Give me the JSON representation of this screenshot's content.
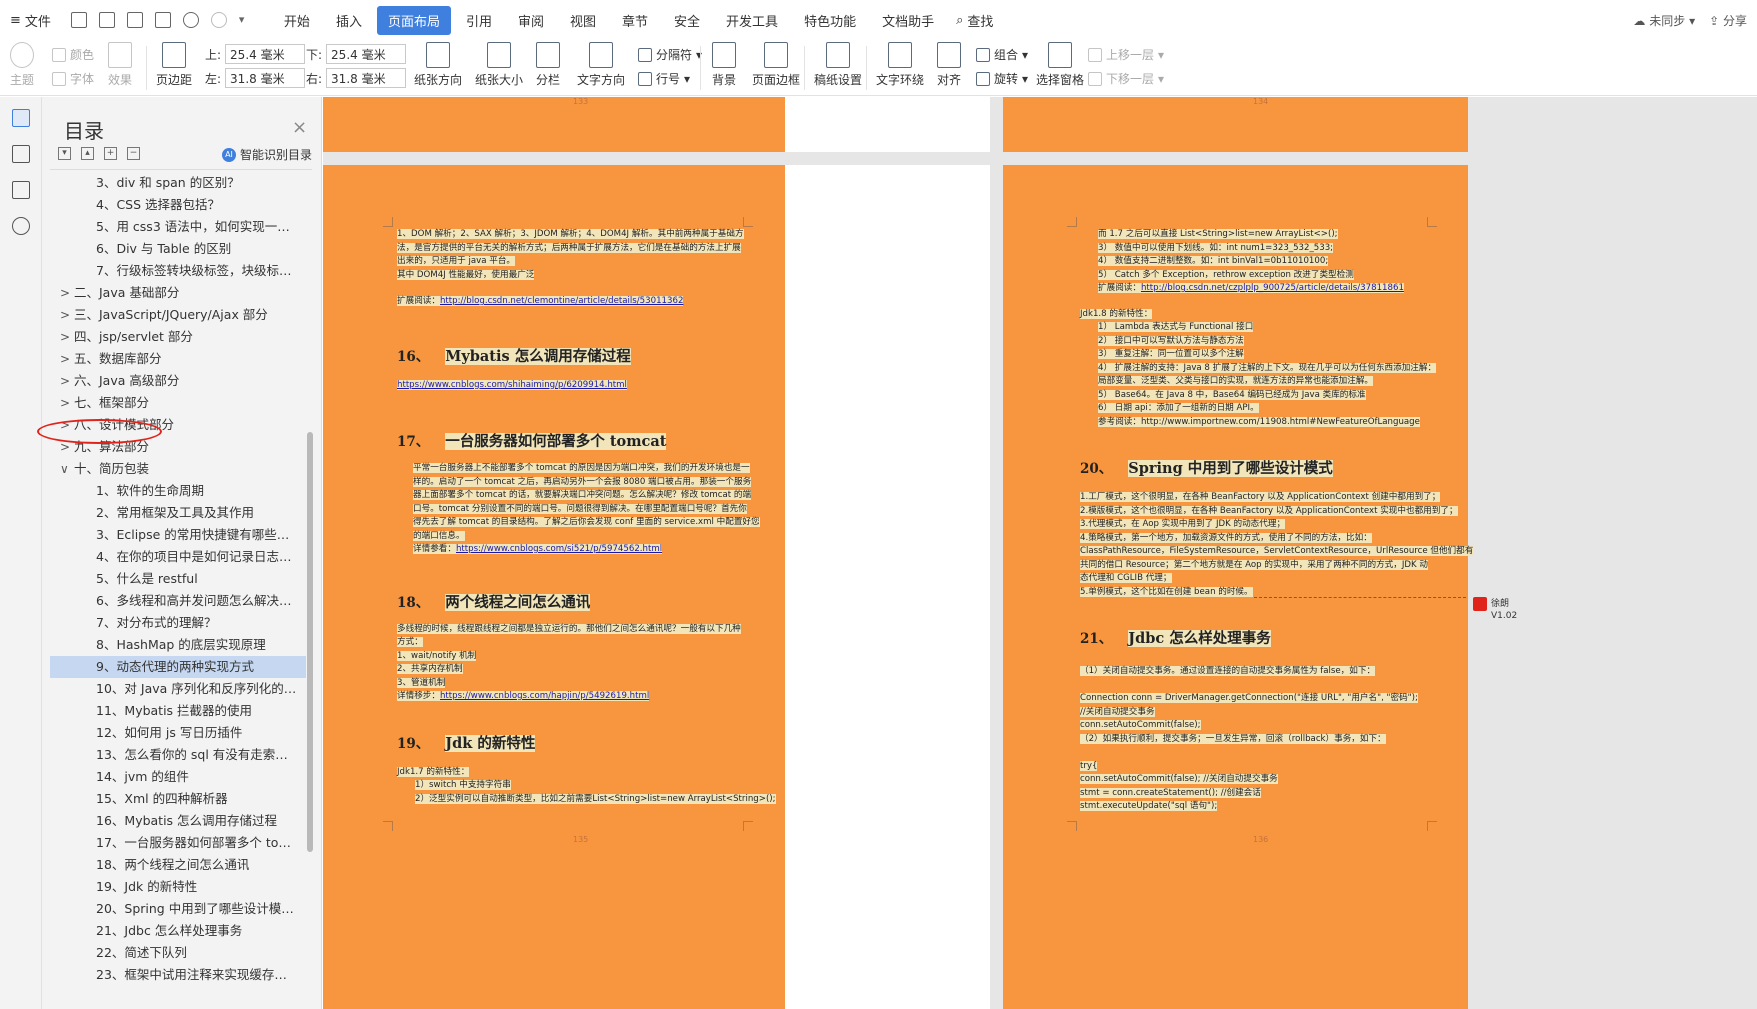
{
  "menubar": {
    "file_label": "文件",
    "tabs": [
      "开始",
      "插入",
      "页面布局",
      "引用",
      "审阅",
      "视图",
      "章节",
      "安全",
      "开发工具",
      "特色功能",
      "文档助手"
    ],
    "active_tab": "页面布局",
    "search_label": "查找",
    "sync_label": "未同步",
    "share_label": "分享"
  },
  "ribbon": {
    "theme": "主题",
    "color": "颜色",
    "font": "字体",
    "effect": "效果",
    "margin": "页边距",
    "top_label": "上:",
    "top_value": "25.4 毫米",
    "bottom_label": "下:",
    "bottom_value": "25.4 毫米",
    "left_label": "左:",
    "left_value": "31.8 毫米",
    "right_label": "右:",
    "right_value": "31.8 毫米",
    "orientation": "纸张方向",
    "size": "纸张大小",
    "columns": "分栏",
    "text_direction": "文字方向",
    "breaks": "分隔符",
    "line_numbers": "行号",
    "background": "背景",
    "page_border": "页面边框",
    "manuscript": "稿纸设置",
    "text_wrap": "文字环绕",
    "align": "对齐",
    "group": "组合",
    "rotate": "旋转",
    "selection_pane": "选择窗格",
    "bring_forward": "上移一层",
    "send_backward": "下移一层"
  },
  "toc": {
    "title": "目录",
    "smart_label": "智能识别目录",
    "items": [
      {
        "text": "3、div 和 span 的区别？",
        "level": 2
      },
      {
        "text": "4、CSS 选择器包括？",
        "level": 2
      },
      {
        "text": "5、用 css3 语法中，如何实现一…",
        "level": 2
      },
      {
        "text": "6、Div 与 Table 的区别",
        "level": 2
      },
      {
        "text": "7、行级标签转块级标签，块级标…",
        "level": 2
      },
      {
        "text": "二、Java 基础部分",
        "level": 1,
        "caret": ">"
      },
      {
        "text": "三、JavaScript/JQuery/Ajax 部分",
        "level": 1,
        "caret": ">"
      },
      {
        "text": "四、jsp/servlet 部分",
        "level": 1,
        "caret": ">"
      },
      {
        "text": "五、数据库部分",
        "level": 1,
        "caret": ">"
      },
      {
        "text": "六、Java 高级部分",
        "level": 1,
        "caret": ">"
      },
      {
        "text": "七、框架部分",
        "level": 1,
        "caret": ">"
      },
      {
        "text": "八、设计模式部分",
        "level": 1,
        "caret": ">"
      },
      {
        "text": "九、算法部分",
        "level": 1,
        "caret": ">"
      },
      {
        "text": "十、简历包装",
        "level": 1,
        "caret": "∨"
      },
      {
        "text": "1、软件的生命周期",
        "level": 2
      },
      {
        "text": "2、常用框架及工具及其作用",
        "level": 2
      },
      {
        "text": "3、Eclipse 的常用快捷键有哪些…",
        "level": 2
      },
      {
        "text": "4、在你的项目中是如何记录日志…",
        "level": 2
      },
      {
        "text": "5、什么是 restful",
        "level": 2
      },
      {
        "text": "6、多线程和高并发问题怎么解决…",
        "level": 2
      },
      {
        "text": "7、对分布式的理解？",
        "level": 2
      },
      {
        "text": "8、HashMap 的底层实现原理",
        "level": 2
      },
      {
        "text": "9、动态代理的两种实现方式",
        "level": 2,
        "selected": true
      },
      {
        "text": "10、对 Java 序列化和反序列化的…",
        "level": 2
      },
      {
        "text": "11、Mybatis 拦截器的使用",
        "level": 2
      },
      {
        "text": "12、如何用 js 写日历插件",
        "level": 2
      },
      {
        "text": "13、怎么看你的 sql 有没有走索…",
        "level": 2
      },
      {
        "text": "14、jvm 的组件",
        "level": 2
      },
      {
        "text": "15、Xml 的四种解析器",
        "level": 2
      },
      {
        "text": "16、Mybatis 怎么调用存储过程",
        "level": 2
      },
      {
        "text": "17、一台服务器如何部署多个 to…",
        "level": 2
      },
      {
        "text": "18、两个线程之间怎么通讯",
        "level": 2
      },
      {
        "text": "19、Jdk 的新特性",
        "level": 2
      },
      {
        "text": "20、Spring 中用到了哪些设计模…",
        "level": 2
      },
      {
        "text": "21、Jdbc 怎么样处理事务",
        "level": 2
      },
      {
        "text": "22、简述下队列",
        "level": 2
      },
      {
        "text": "23、框架中试用注释来实现缓存…",
        "level": 2
      }
    ]
  },
  "pages": {
    "top_left_num": "133",
    "top_right_num": "134",
    "left_num": "135",
    "right_num": "136"
  },
  "left_page": {
    "intro": [
      "1、DOM 解析；2、SAX 解析；3、JDOM 解析；4、DOM4J 解析。其中前两种属于基础方",
      "法，是官方提供的平台无关的解析方式；后两种属于扩展方法，它们是在基础的方法上扩展",
      "出来的，只适用于 java 平台。",
      "其中 DOM4J 性能最好，使用最广泛"
    ],
    "ext_read_label": "扩展阅读：",
    "ext_read_link": "http://blog.csdn.net/clemontine/article/details/53011362",
    "h16_num": "16、",
    "h16": "Mybatis 怎么调用存储过程",
    "h16_link": "https://www.cnblogs.com/shihaiming/p/6209914.html",
    "h17_num": "17、",
    "h17": "一台服务器如何部署多个 tomcat",
    "s17": [
      "平常一台服务器上不能部署多个 tomcat 的原因是因为端口冲突，我们的开发环境也是一",
      "样的。启动了一个 tomcat 之后，再启动另外一个会报 8080 端口被占用。那装一个服务",
      "器上面部署多个 tomcat 的话，就要解决端口冲突问题。怎么解决呢？修改 tomcat 的端",
      "口号。tomcat 分别设置不同的端口号。问题很得到解决。在哪里配置端口号呢？首先你",
      "得先去了解 tomcat 的目录结构。了解之后你会发现 conf 里面的 service.xml 中配置好您",
      "的端口信息。"
    ],
    "s17_ref_label": "详情参看：",
    "s17_ref_link": "https://www.cnblogs.com/si521/p/5974562.html",
    "h18_num": "18、",
    "h18": "两个线程之间怎么通讯",
    "s18": [
      "多线程的时候，线程跟线程之间都是独立运行的。那他们之间怎么通讯呢？一般有以下几种",
      "方式：",
      "1、wait/notify 机制",
      "2、共享内存机制",
      "3、管道机制"
    ],
    "s18_ref_label": "详情移步：",
    "s18_ref_link": "https://www.cnblogs.com/hapjin/p/5492619.html",
    "h19_num": "19、",
    "h19": "Jdk 的新特性",
    "s19": [
      "Jdk1.7 的新特性：",
      "1）switch 中支持字符串",
      "2）泛型实例可以自动推断类型，比如之前需要List<String>list=new ArrayList<String>();"
    ]
  },
  "right_page": {
    "top": [
      "而 1.7 之后可以直接 List<String>list=new ArrayList<>();",
      "3）  数值中可以使用下划线。如：int num1=323_532_533;",
      "4）  数值支持二进制整数。如：int binVal1=0b11010100;",
      "5）  Catch 多个 Exception，rethrow exception 改进了类型检测"
    ],
    "top_ref_label": "扩展阅读：",
    "top_ref_link": "http://blog.csdn.net/czplplp_900725/article/details/37811861",
    "jdk18": [
      "Jdk1.8 的新特性：",
      "1）  Lambda 表达式与 Functional 接口",
      "2）  接口中可以写默认方法与静态方法",
      "3）  重复注解：同一位置可以多个注解",
      "4）  扩展注解的支持：Java 8 扩展了注解的上下文。现在几乎可以为任何东西添加注解：",
      "局部变量、泛型类、父类与接口的实现，就连方法的异常也能添加注解。",
      "5）  Base64。在 Java 8 中，Base64 编码已经成为 Java 类库的标准",
      "6）  日期 api：添加了一组新的日期 API。"
    ],
    "jdk18_ref": "参考阅读：http://www.importnew.com/11908.html#NewFeatureOfLanguage",
    "h20_num": "20、",
    "h20": "Spring 中用到了哪些设计模式",
    "s20": [
      "1.工厂模式，这个很明显，在各种 BeanFactory 以及 ApplicationContext 创建中都用到了；",
      "2.模版模式，这个也很明显，在各种 BeanFactory 以及 ApplicationContext 实现中也都用到了；",
      "3.代理模式，在 Aop 实现中用到了 JDK 的动态代理；",
      "4.策略模式，第一个地方，加载资源文件的方式，使用了不同的方法，比如：",
      "ClassPathResource，FileSystemResource，ServletContextResource，UrlResource 但他们都有",
      "共同的借口 Resource；第二个地方就是在 Aop 的实现中，采用了两种不同的方式，JDK 动",
      "态代理和 CGLIB 代理；",
      "5.单例模式，这个比如在创建 bean 的时候。"
    ],
    "h21_num": "21、",
    "h21": "Jdbc 怎么样处理事务",
    "s21": [
      "（1）关闭自动提交事务。通过设置连接的自动提交事务属性为 false，如下：",
      "",
      "Connection conn = DriverManager.getConnection(\"连接 URL\", \"用户名\", \"密码\");",
      "//关闭自动提交事务",
      "conn.setAutoCommit(false);",
      "（2）如果执行顺利，提交事务；一旦发生异常，回滚（rollback）事务，如下：",
      "",
      "try{",
      "        conn.setAutoCommit(false);        //关闭自动提交事务",
      "        stmt = conn.createStatement();        //创建会话",
      "        stmt.executeUpdate(\"sql 语句\");"
    ],
    "comment_author": "徐朗",
    "comment_version": "V1.02"
  }
}
